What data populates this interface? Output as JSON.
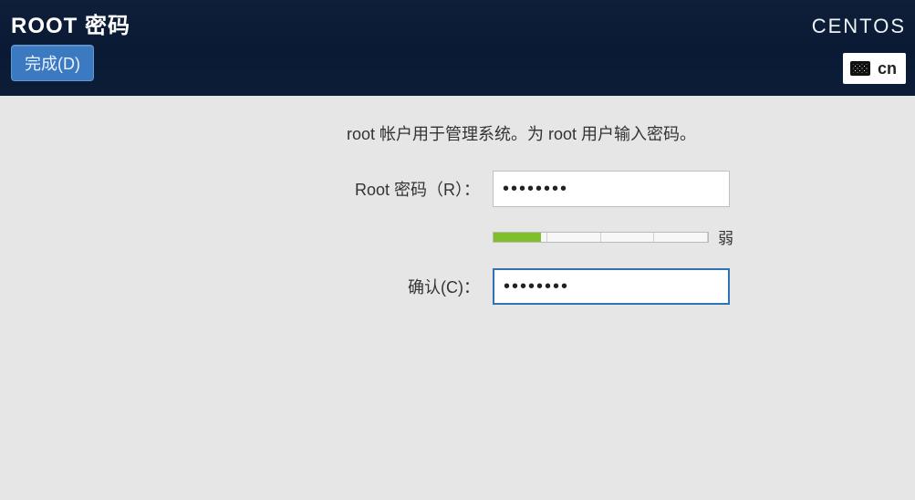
{
  "header": {
    "title": "ROOT 密码",
    "done_label": "完成(D)",
    "brand": "CENTOS",
    "lang": "cn"
  },
  "form": {
    "description": "root 帐户用于管理系统。为 root 用户输入密码。",
    "password_label": "Root 密码（R）：",
    "confirm_label": "确认(C)：",
    "password_value": "••••••••",
    "confirm_value": "••••••••",
    "strength_label": "弱",
    "strength_percent": 22
  }
}
